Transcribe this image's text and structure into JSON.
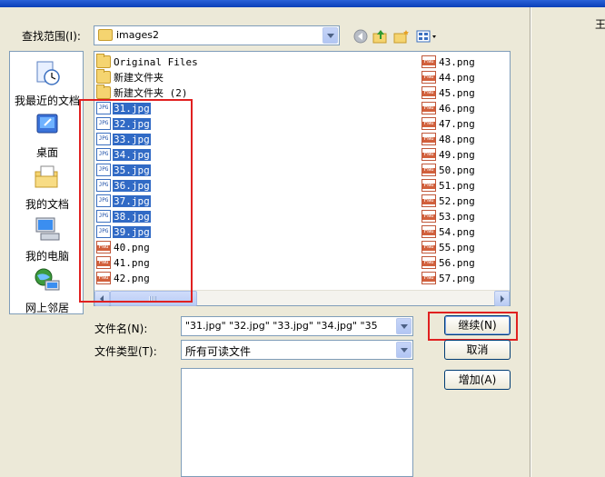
{
  "dialog": {
    "look_in_label": "查找范围(I):",
    "look_in_value": "images2",
    "file_name_label": "文件名(N):",
    "file_name_value": "\"31.jpg\" \"32.jpg\" \"33.jpg\" \"34.jpg\" \"35",
    "file_type_label": "文件类型(T):",
    "file_type_value": "所有可读文件",
    "right_glyph": "王"
  },
  "places": [
    {
      "label": "我最近的文档",
      "icon": "recent-documents-icon"
    },
    {
      "label": "桌面",
      "icon": "desktop-icon"
    },
    {
      "label": "我的文档",
      "icon": "my-documents-icon"
    },
    {
      "label": "我的电脑",
      "icon": "my-computer-icon"
    },
    {
      "label": "网上邻居",
      "icon": "network-places-icon"
    }
  ],
  "files": [
    {
      "name": "Original Files",
      "type": "folder",
      "selected": false
    },
    {
      "name": "新建文件夹",
      "type": "folder",
      "selected": false
    },
    {
      "name": "新建文件夹 (2)",
      "type": "folder",
      "selected": false
    },
    {
      "name": "31.jpg",
      "type": "jpg",
      "selected": true
    },
    {
      "name": "32.jpg",
      "type": "jpg",
      "selected": true
    },
    {
      "name": "33.jpg",
      "type": "jpg",
      "selected": true
    },
    {
      "name": "34.jpg",
      "type": "jpg",
      "selected": true
    },
    {
      "name": "35.jpg",
      "type": "jpg",
      "selected": true
    },
    {
      "name": "36.jpg",
      "type": "jpg",
      "selected": true
    },
    {
      "name": "37.jpg",
      "type": "jpg",
      "selected": true
    },
    {
      "name": "38.jpg",
      "type": "jpg",
      "selected": true
    },
    {
      "name": "39.jpg",
      "type": "jpg",
      "selected": true
    },
    {
      "name": "40.png",
      "type": "png",
      "selected": false
    },
    {
      "name": "41.png",
      "type": "png",
      "selected": false
    },
    {
      "name": "42.png",
      "type": "png",
      "selected": false
    },
    {
      "name": "43.png",
      "type": "png",
      "selected": false
    },
    {
      "name": "44.png",
      "type": "png",
      "selected": false
    },
    {
      "name": "45.png",
      "type": "png",
      "selected": false
    },
    {
      "name": "46.png",
      "type": "png",
      "selected": false
    },
    {
      "name": "47.png",
      "type": "png",
      "selected": false
    },
    {
      "name": "48.png",
      "type": "png",
      "selected": false
    },
    {
      "name": "49.png",
      "type": "png",
      "selected": false
    },
    {
      "name": "50.png",
      "type": "png",
      "selected": false
    },
    {
      "name": "51.png",
      "type": "png",
      "selected": false
    },
    {
      "name": "52.png",
      "type": "png",
      "selected": false
    },
    {
      "name": "53.png",
      "type": "png",
      "selected": false
    },
    {
      "name": "54.png",
      "type": "png",
      "selected": false
    },
    {
      "name": "55.png",
      "type": "png",
      "selected": false
    },
    {
      "name": "56.png",
      "type": "png",
      "selected": false
    },
    {
      "name": "57.png",
      "type": "png",
      "selected": false
    }
  ],
  "buttons": {
    "continue": "继续(N)",
    "cancel": "取消",
    "add": "增加(A)"
  },
  "colors": {
    "selection": "#316ac5",
    "highlight_box": "#e02020",
    "dialog_bg": "#ece9d8"
  }
}
